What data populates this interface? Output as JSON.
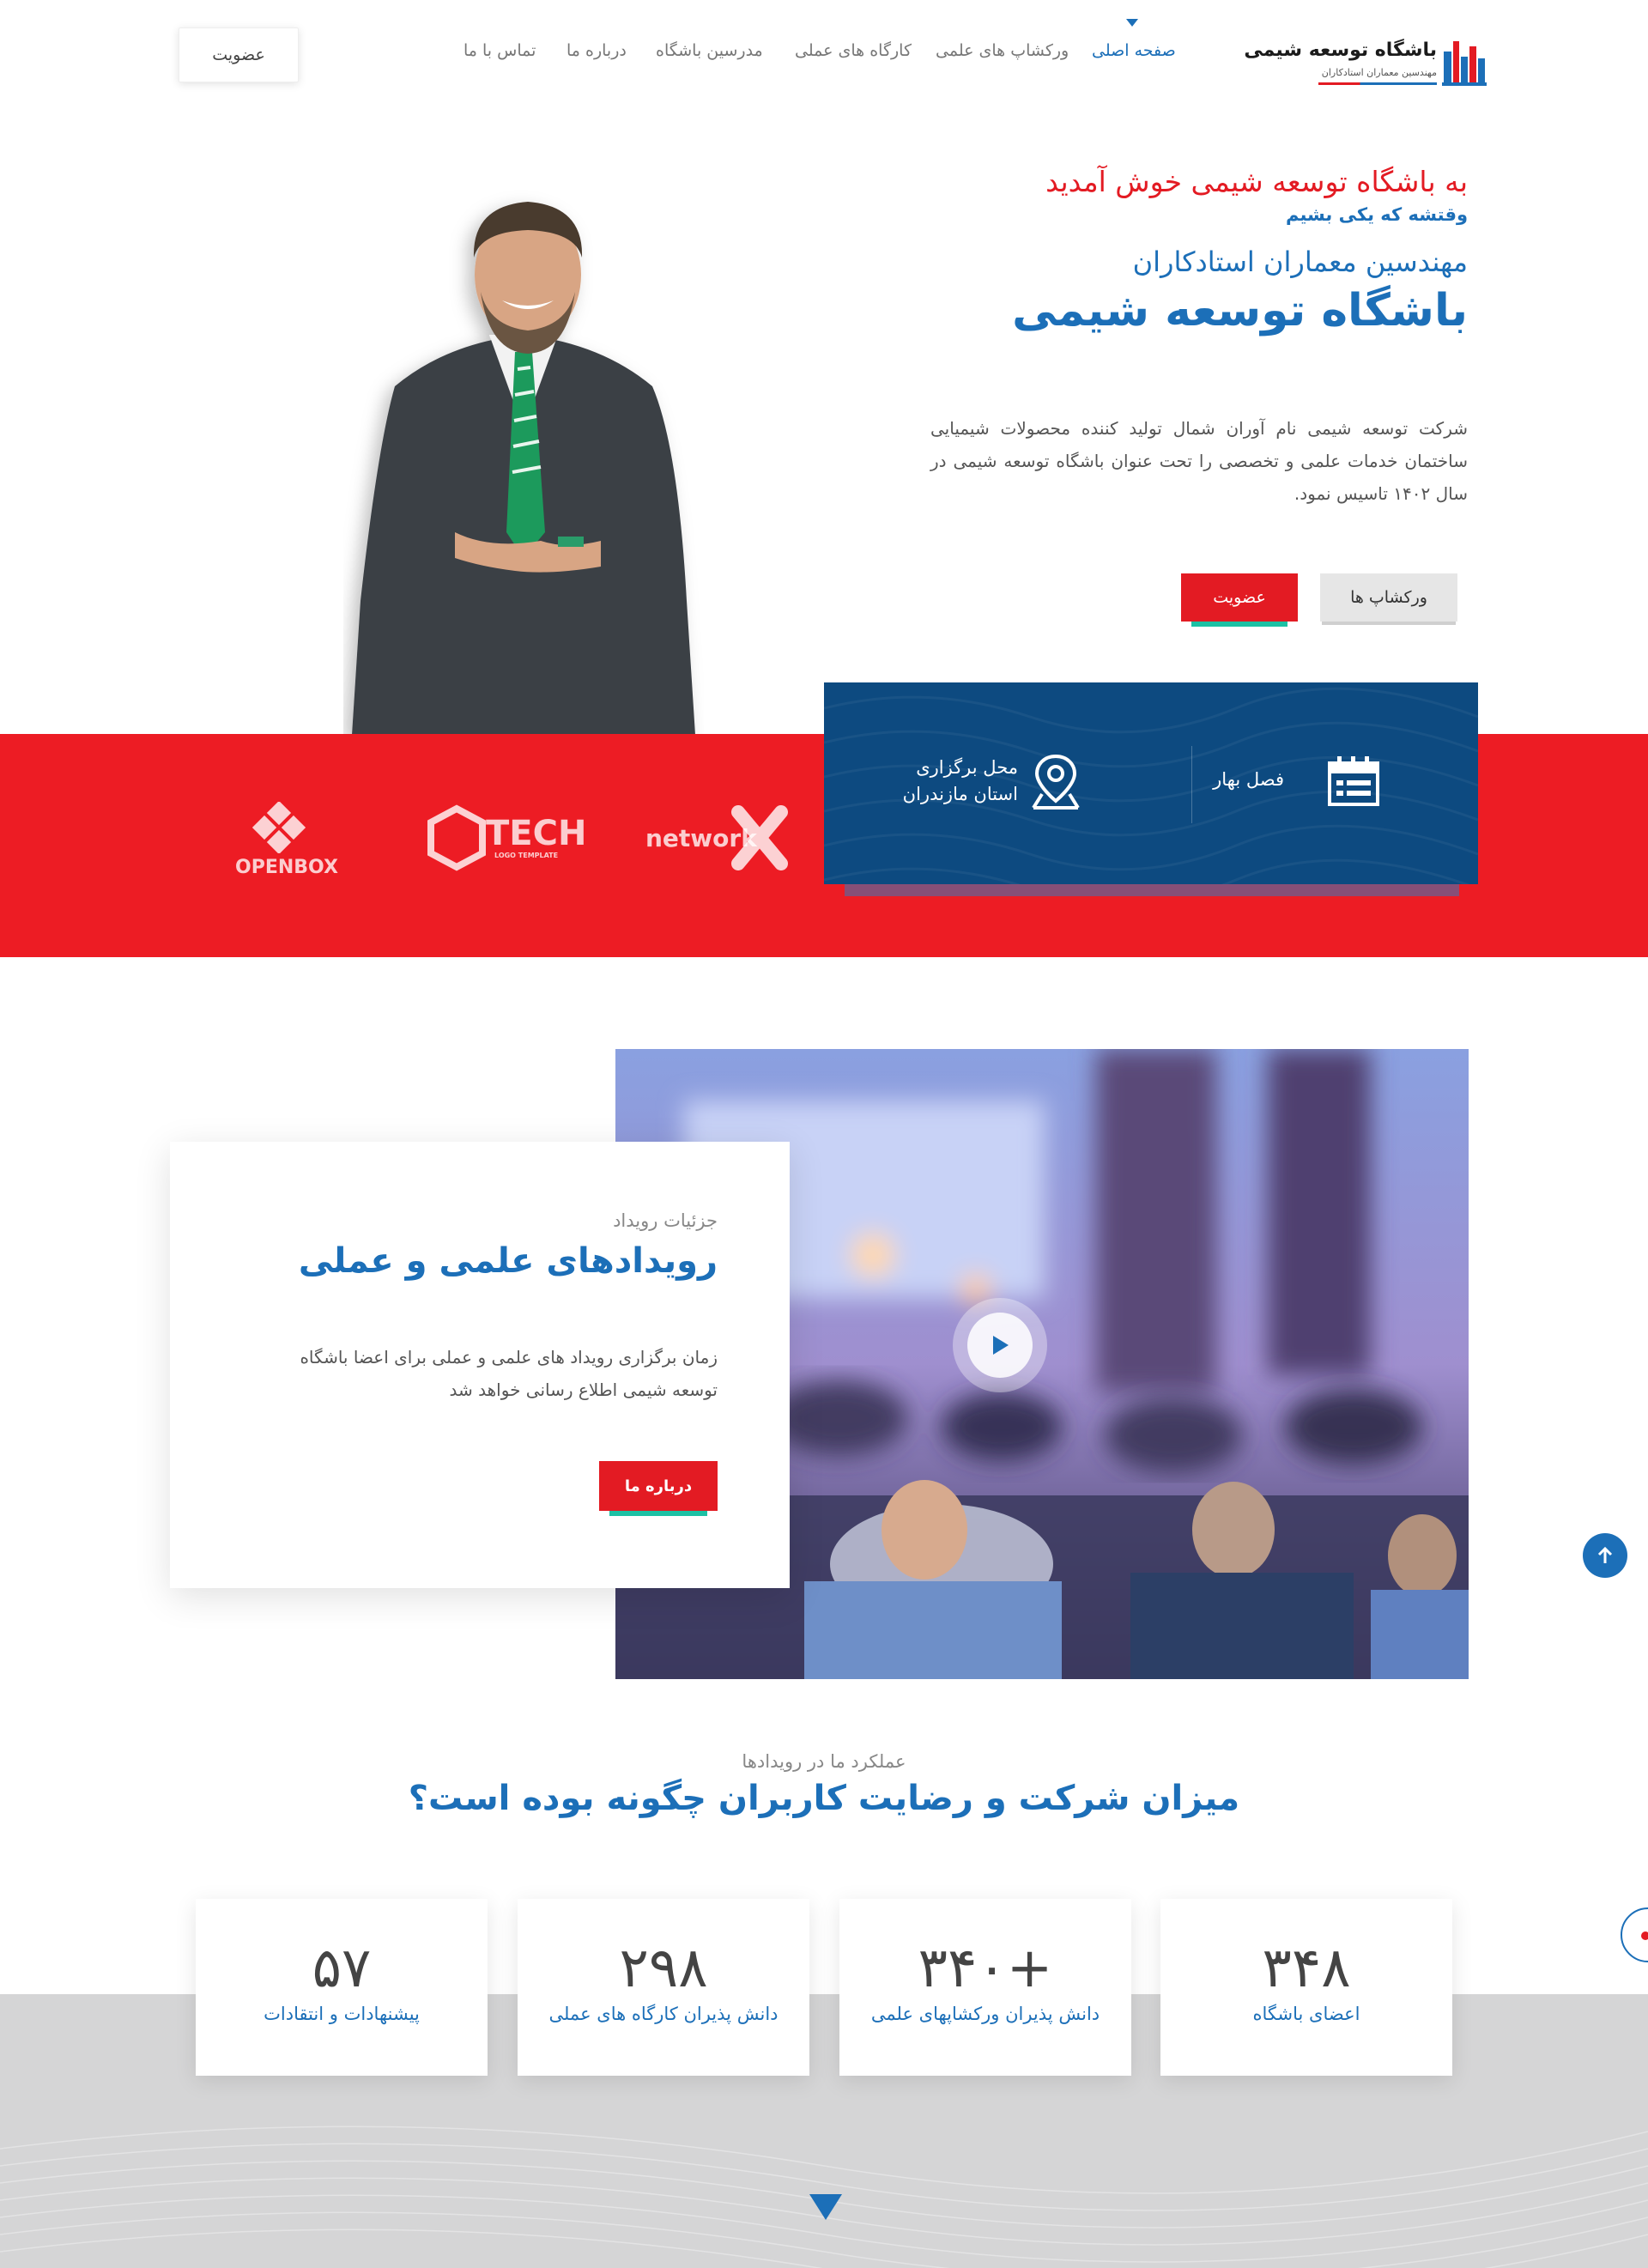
{
  "header": {
    "logo": {
      "title": "باشگاه توسعه شیمی",
      "subtitle": "مهندسین معماران استادکاران"
    },
    "nav": [
      {
        "label": "صفحه اصلی",
        "active": true
      },
      {
        "label": "ورکشاپ های علمی",
        "active": false
      },
      {
        "label": "کارگاه های عملی",
        "active": false
      },
      {
        "label": "مدرسین باشگاه",
        "active": false
      },
      {
        "label": "درباره ما",
        "active": false
      },
      {
        "label": "تماس با ما",
        "active": false
      }
    ],
    "join_button": "عضویت"
  },
  "hero": {
    "welcome": "به باشگاه توسعه شیمی خوش آمدید",
    "tagline": "وقتشه که یکی بشیم",
    "company": "مهندسین معماران استادکاران",
    "title": "باشگاه توسعه شیمی",
    "description": "شرکت توسعه شیمی نام آوران شمال تولید کننده محصولات شیمیایی ساختمان خدمات علمی و تخصصی را تحت عنوان باشگاه توسعه شیمی در سال ۱۴۰۲ تاسیس نمود.",
    "btn_workshops": "ورکشاپ ها",
    "btn_join": "عضویت"
  },
  "info_card": {
    "season": "فصل بهار",
    "location_label": "محل برگزاری",
    "location_value": "استان مازندران"
  },
  "partners": [
    {
      "name": "network",
      "icon": "network-x-logo"
    },
    {
      "name": "TECH",
      "tagline": "LOGO TEMPLATE",
      "icon": "tech-hexagon-logo"
    },
    {
      "name": "OPENBOX",
      "icon": "openbox-logo"
    }
  ],
  "events": {
    "subtitle": "جزئیات رویداد",
    "title": "رویدادهای علمی و عملی",
    "description": "زمان برگزاری رویداد های علمی و عملی برای اعضا باشگاه توسعه شیمی اطلاع رسانی خواهد شد",
    "button": "درباره ما"
  },
  "stats": {
    "subtitle": "عملکرد ما در رویدادها",
    "title": "میزان شرکت و رضایت کاربران چگونه بوده است؟",
    "items": [
      {
        "number": "۳۴۸",
        "label": "اعضای باشگاه"
      },
      {
        "number": "+۳۴۰",
        "label": "دانش پذیران ورکشاپهای علمی"
      },
      {
        "number": "۲۹۸",
        "label": "دانش پذیران کارگاه های عملی"
      },
      {
        "number": "۵۷",
        "label": "پیشنهادات و انتقادات"
      }
    ]
  },
  "colors": {
    "primary_blue": "#1c6fb8",
    "brand_red": "#ed1c24",
    "navy": "#0d4a80",
    "accent_teal": "#1cc1a4"
  }
}
